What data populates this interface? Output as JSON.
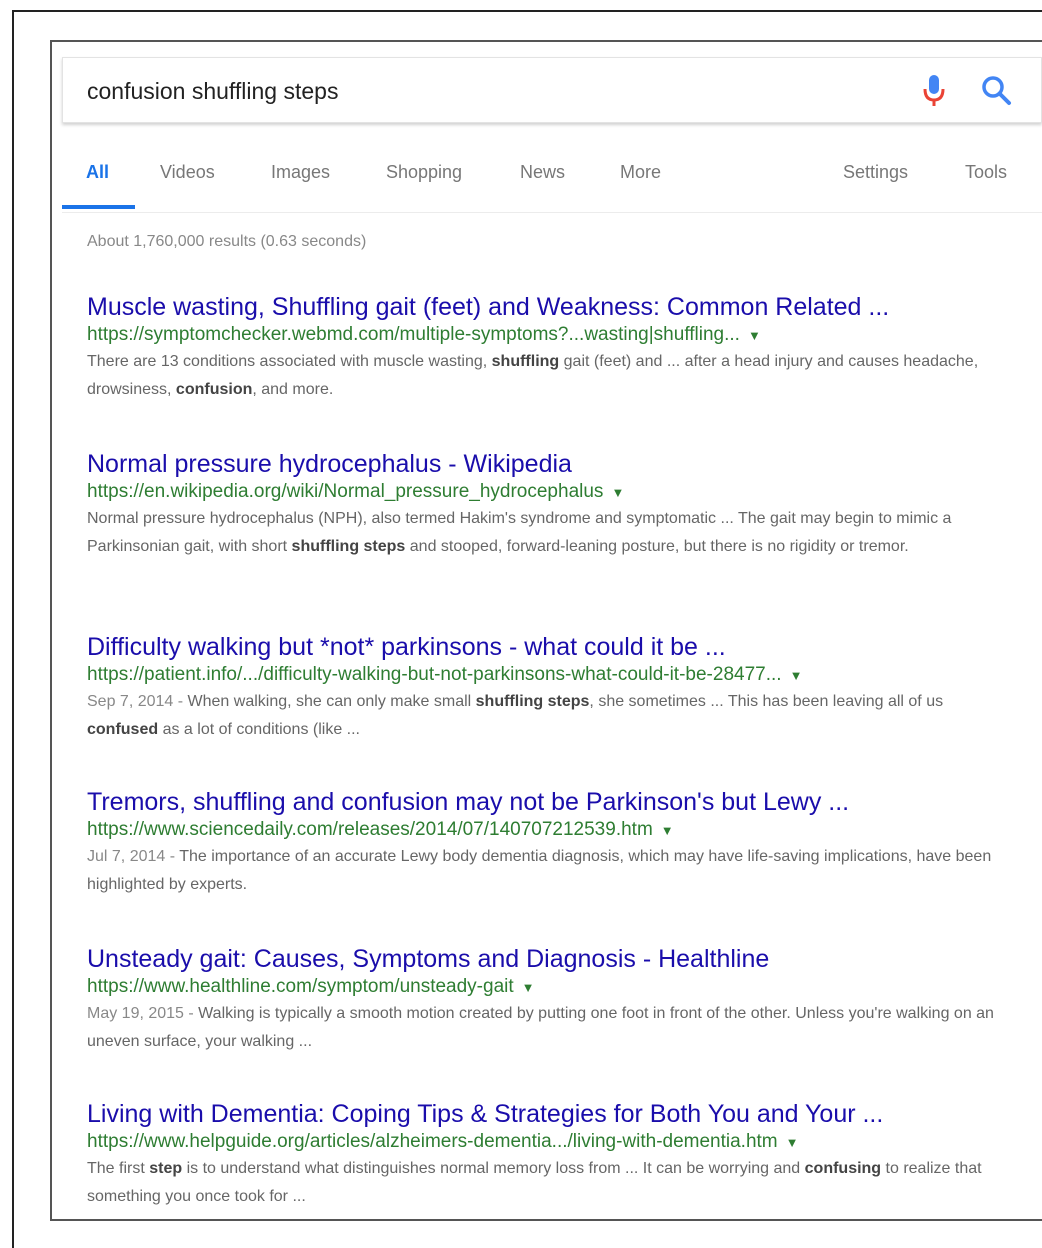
{
  "search": {
    "query": "confusion shuffling steps"
  },
  "tabs": [
    "All",
    "Videos",
    "Images",
    "Shopping",
    "News",
    "More",
    "Settings",
    "Tools"
  ],
  "stats": "About 1,760,000 results (0.63 seconds)",
  "colors": {
    "link": "#1a0dab",
    "url": "#2e7d32",
    "accent": "#1a73e8",
    "mic_blue": "#4285f4",
    "mic_red": "#ea4335"
  },
  "results": [
    {
      "title": "Muscle wasting, Shuffling gait (feet) and Weakness: Common Related ...",
      "url": "https://symptomchecker.webmd.com/multiple-symptoms?...wasting|shuffling...",
      "snippet": [
        {
          "t": "There are 13 conditions associated with muscle wasting, "
        },
        {
          "t": "shuffling",
          "b": true
        },
        {
          "t": " gait (feet) and ... after a head injury and causes headache, drowsiness, "
        },
        {
          "t": "confusion",
          "b": true
        },
        {
          "t": ", and more."
        }
      ]
    },
    {
      "title": "Normal pressure hydrocephalus - Wikipedia",
      "url": "https://en.wikipedia.org/wiki/Normal_pressure_hydrocephalus",
      "snippet": [
        {
          "t": "Normal pressure hydrocephalus (NPH), also termed Hakim's syndrome and symptomatic ... The gait may begin to mimic a Parkinsonian gait, with short "
        },
        {
          "t": "shuffling steps",
          "b": true
        },
        {
          "t": " and stooped, forward-leaning posture, but there is no rigidity or tremor."
        }
      ]
    },
    {
      "title": "Difficulty walking but *not* parkinsons - what could it be ...",
      "url": "https://patient.info/.../difficulty-walking-but-not-parkinsons-what-could-it-be-28477...",
      "date": "Sep 7, 2014 - ",
      "snippet": [
        {
          "t": "When walking, she can only make small "
        },
        {
          "t": "shuffling steps",
          "b": true
        },
        {
          "t": ", she sometimes ... This has been leaving all of us "
        },
        {
          "t": "confused",
          "b": true
        },
        {
          "t": " as a lot of conditions (like ..."
        }
      ]
    },
    {
      "title": "Tremors, shuffling and confusion may not be Parkinson's but Lewy ...",
      "url": "https://www.sciencedaily.com/releases/2014/07/140707212539.htm",
      "date": "Jul 7, 2014 - ",
      "snippet": [
        {
          "t": "The importance of an accurate Lewy body dementia diagnosis, which may have life-saving implications, have been highlighted by experts."
        }
      ]
    },
    {
      "title": "Unsteady gait: Causes, Symptoms and Diagnosis - Healthline",
      "url": "https://www.healthline.com/symptom/unsteady-gait",
      "date": "May 19, 2015 - ",
      "snippet": [
        {
          "t": "Walking is typically a smooth motion created by putting one foot in front of the other. Unless you're walking on an uneven surface, your walking ..."
        }
      ]
    },
    {
      "title": "Living with Dementia: Coping Tips & Strategies for Both You and Your ...",
      "url": "https://www.helpguide.org/articles/alzheimers-dementia.../living-with-dementia.htm",
      "snippet": [
        {
          "t": "The first "
        },
        {
          "t": "step",
          "b": true
        },
        {
          "t": " is to understand what distinguishes normal memory loss from ... It can be worrying and "
        },
        {
          "t": "confusing",
          "b": true
        },
        {
          "t": " to realize that something you once took for ..."
        }
      ]
    }
  ]
}
